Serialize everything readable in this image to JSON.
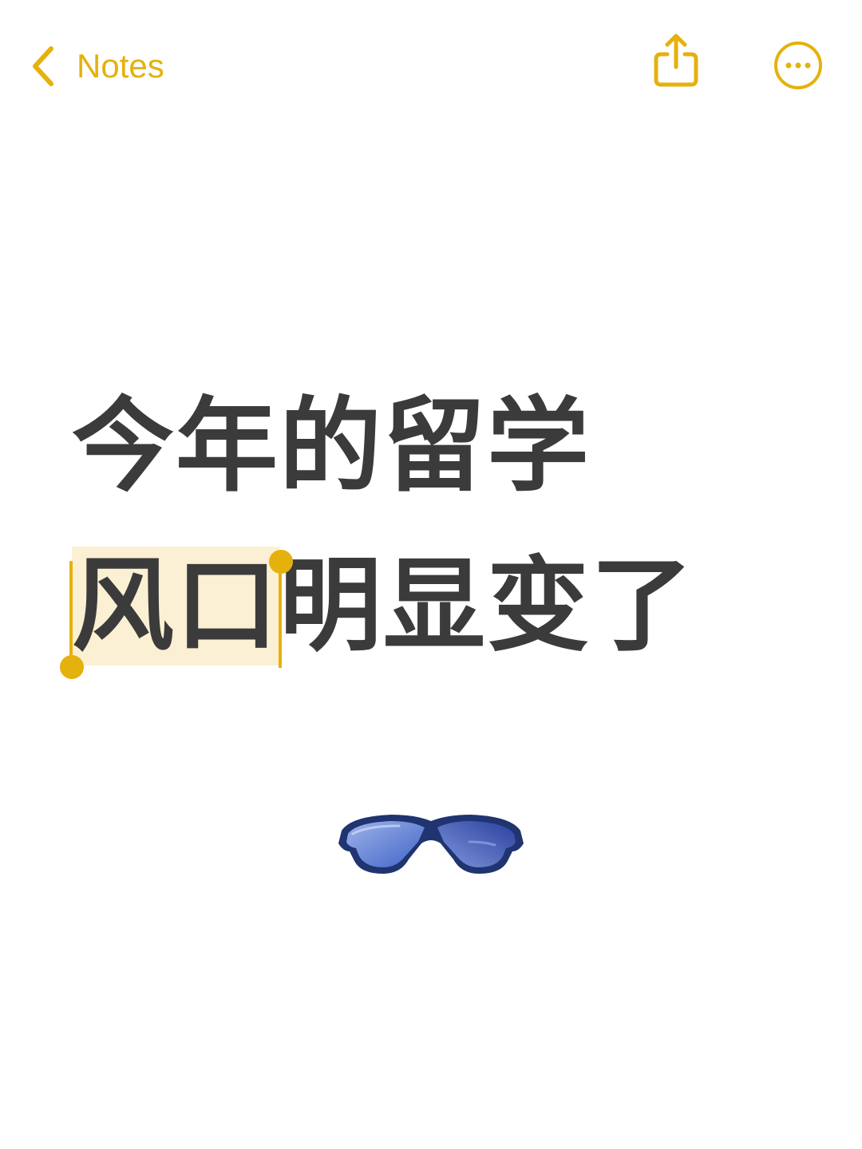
{
  "colors": {
    "accent": "#E5B10D",
    "text": "#3b3b3b",
    "selection": "#FBF0D3",
    "background": "#ffffff"
  },
  "nav": {
    "back_label": "Notes",
    "back_icon": "chevron-left-icon",
    "share_icon": "share-icon",
    "more_icon": "ellipsis-circle-icon"
  },
  "note": {
    "line1": "今年的留学",
    "line2_selected": "风口",
    "line2_rest": "明显变了",
    "emoji": "sunglasses-icon"
  }
}
